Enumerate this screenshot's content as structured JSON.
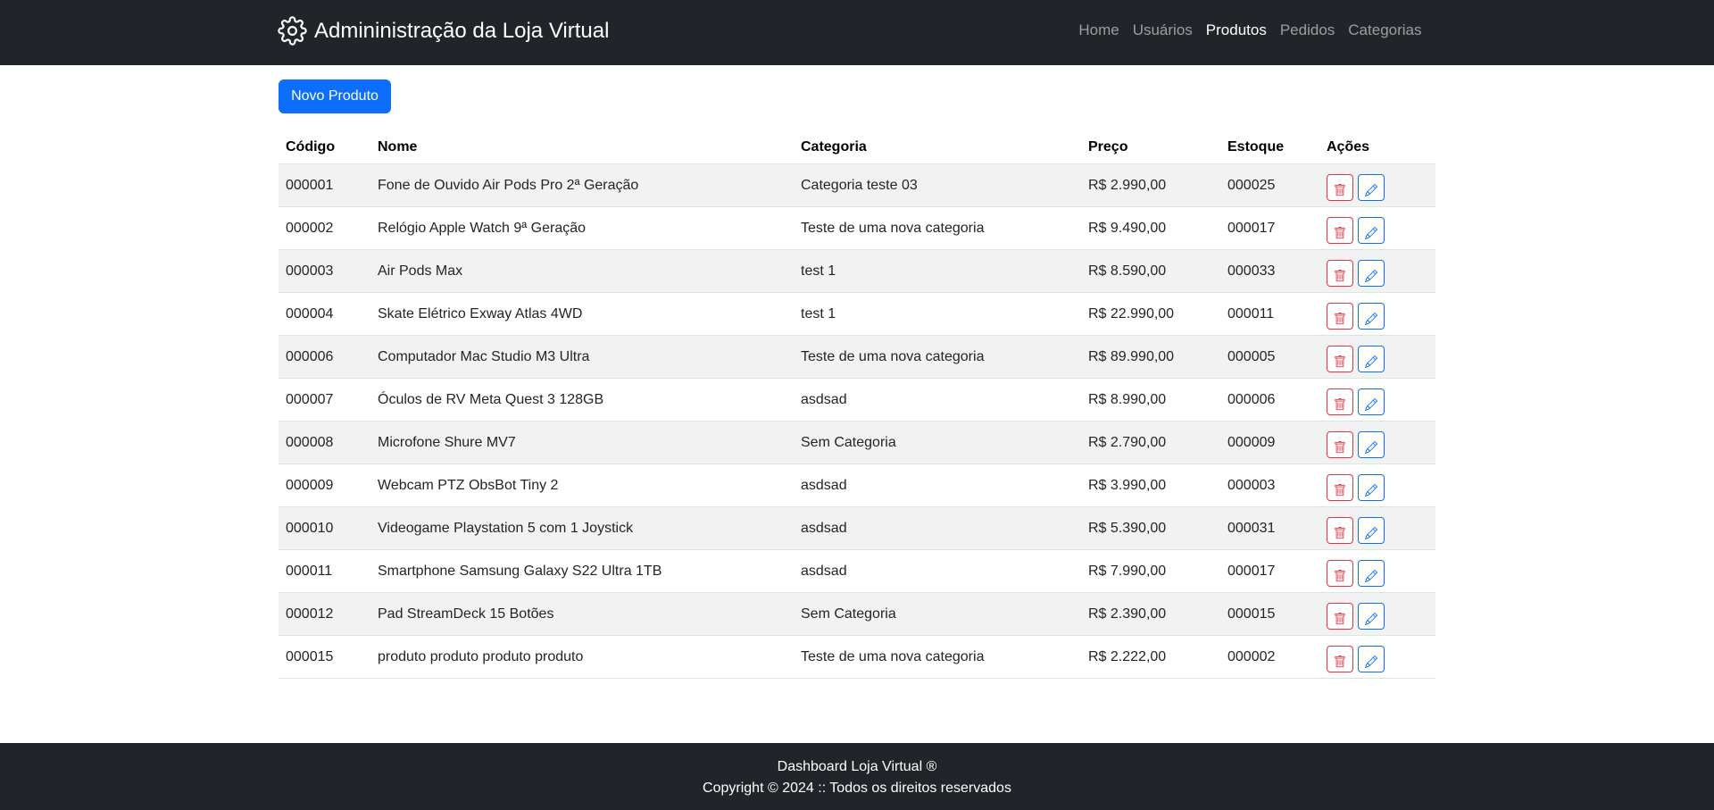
{
  "header": {
    "brand": "Admininistração da Loja Virtual",
    "brand_icon": "gear-icon",
    "nav": [
      {
        "label": "Home",
        "active": false
      },
      {
        "label": "Usuários",
        "active": false
      },
      {
        "label": "Produtos",
        "active": true
      },
      {
        "label": "Pedidos",
        "active": false
      },
      {
        "label": "Categorias",
        "active": false
      }
    ]
  },
  "toolbar": {
    "new_product_label": "Novo Produto"
  },
  "table": {
    "columns": [
      "Código",
      "Nome",
      "Categoria",
      "Preço",
      "Estoque",
      "Ações"
    ],
    "rows": [
      {
        "code": "000001",
        "name": "Fone de Ouvido Air Pods Pro 2ª Geração",
        "category": "Categoria teste 03",
        "price": "R$ 2.990,00",
        "stock": "000025"
      },
      {
        "code": "000002",
        "name": "Relógio Apple Watch 9ª Geração",
        "category": "Teste de uma nova categoria",
        "price": "R$ 9.490,00",
        "stock": "000017"
      },
      {
        "code": "000003",
        "name": "Air Pods Max",
        "category": "test 1",
        "price": "R$ 8.590,00",
        "stock": "000033"
      },
      {
        "code": "000004",
        "name": "Skate Elétrico Exway Atlas 4WD",
        "category": "test 1",
        "price": "R$ 22.990,00",
        "stock": "000011"
      },
      {
        "code": "000006",
        "name": "Computador Mac Studio M3 Ultra",
        "category": "Teste de uma nova categoria",
        "price": "R$ 89.990,00",
        "stock": "000005"
      },
      {
        "code": "000007",
        "name": "Óculos de RV Meta Quest 3 128GB",
        "category": "asdsad",
        "price": "R$ 8.990,00",
        "stock": "000006"
      },
      {
        "code": "000008",
        "name": "Microfone Shure MV7",
        "category": "Sem Categoria",
        "price": "R$ 2.790,00",
        "stock": "000009"
      },
      {
        "code": "000009",
        "name": "Webcam PTZ ObsBot Tiny 2",
        "category": "asdsad",
        "price": "R$ 3.990,00",
        "stock": "000003"
      },
      {
        "code": "000010",
        "name": "Videogame Playstation 5 com 1 Joystick",
        "category": "asdsad",
        "price": "R$ 5.390,00",
        "stock": "000031"
      },
      {
        "code": "000011",
        "name": "Smartphone Samsung Galaxy S22 Ultra 1TB",
        "category": "asdsad",
        "price": "R$ 7.990,00",
        "stock": "000017"
      },
      {
        "code": "000012",
        "name": "Pad StreamDeck 15 Botões",
        "category": "Sem Categoria",
        "price": "R$ 2.390,00",
        "stock": "000015"
      },
      {
        "code": "000015",
        "name": "produto produto produto produto",
        "category": "Teste de uma nova categoria",
        "price": "R$ 2.222,00",
        "stock": "000002"
      }
    ],
    "actions": {
      "delete_icon": "trash-icon",
      "edit_icon": "pencil-icon"
    }
  },
  "footer": {
    "line1": "Dashboard Loja Virtual ®",
    "line2": "Copyright © 2024 :: Todos os direitos reservados"
  },
  "colors": {
    "navbar_bg": "#212529",
    "primary": "#0d6efd",
    "danger": "#dc3545",
    "stripe": "#f2f2f2"
  }
}
